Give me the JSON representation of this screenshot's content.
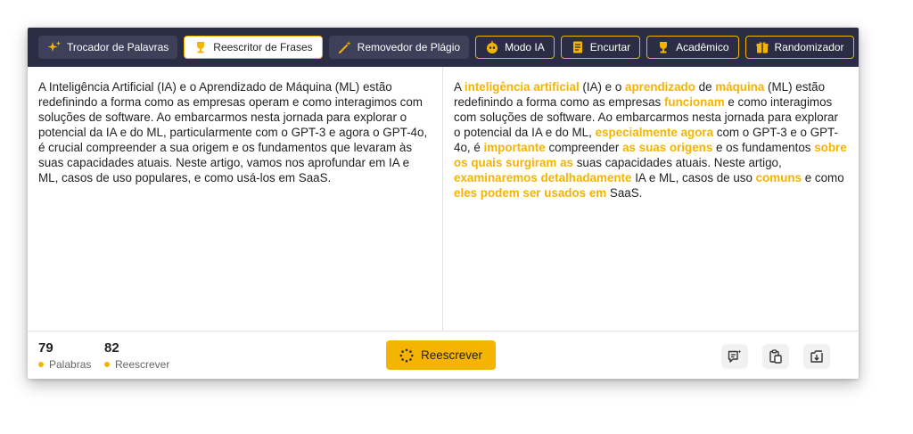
{
  "toolbar": {
    "modes": [
      {
        "label": "Trocador de Palavras",
        "icon": "sparkle-icon"
      },
      {
        "label": "Reescritor de Frases",
        "icon": "trophy-icon"
      },
      {
        "label": "Removedor de Plágio",
        "icon": "magic-wand-icon"
      },
      {
        "label": "Modo IA",
        "icon": "robot-icon"
      },
      {
        "label": "Encurtar",
        "icon": "document-icon"
      },
      {
        "label": "Acadêmico",
        "icon": "trophy-icon"
      },
      {
        "label": "Randomizador",
        "icon": "gift-icon"
      }
    ],
    "active_mode": "Reescritor de Frases"
  },
  "input_text": "A Inteligência Artificial (IA) e o Aprendizado de Máquina (ML) estão redefinindo a forma como as empresas operam e como interagimos com soluções de software. Ao embarcarmos nesta jornada para explorar o potencial da IA e do ML, particularmente com o GPT-3 e agora o GPT-4o, é crucial compreender a sua origem e os fundamentos que levaram às suas capacidades atuais. Neste artigo, vamos nos aprofundar em IA e ML, casos de uso populares, e como usá-los em SaaS.",
  "output_segments": [
    {
      "text": "A ",
      "changed": false
    },
    {
      "text": "inteligência artificial",
      "changed": true
    },
    {
      "text": " (IA) e o ",
      "changed": false
    },
    {
      "text": "aprendizado",
      "changed": true
    },
    {
      "text": " de ",
      "changed": false
    },
    {
      "text": "máquina",
      "changed": true
    },
    {
      "text": " (ML) estão redefinindo a forma como as empresas ",
      "changed": false
    },
    {
      "text": "funcionam",
      "changed": true
    },
    {
      "text": " e como interagimos com soluções de software. Ao embarcarmos nesta jornada para explorar o potencial da IA e do ML, ",
      "changed": false
    },
    {
      "text": "especialmente agora",
      "changed": true
    },
    {
      "text": " com o GPT-3 e o GPT-4o, é ",
      "changed": false
    },
    {
      "text": "importante",
      "changed": true
    },
    {
      "text": " compreender ",
      "changed": false
    },
    {
      "text": "as suas origens",
      "changed": true
    },
    {
      "text": " e os fundamentos ",
      "changed": false
    },
    {
      "text": "sobre os quais surgiram as",
      "changed": true
    },
    {
      "text": " suas capacidades atuais. Neste artigo, ",
      "changed": false
    },
    {
      "text": "examinaremos detalhadamente",
      "changed": true
    },
    {
      "text": " IA e ML, casos de uso ",
      "changed": false
    },
    {
      "text": "comuns",
      "changed": true
    },
    {
      "text": " e como ",
      "changed": false
    },
    {
      "text": "eles podem ser usados em",
      "changed": true
    },
    {
      "text": " SaaS.",
      "changed": false
    }
  ],
  "stats": {
    "words_count": "79",
    "words_label": "Palabras",
    "rewrite_count": "82",
    "rewrite_label": "Reescrever"
  },
  "rewrite_button": {
    "label": "Reescrever",
    "icon": "spinner-icon"
  },
  "tools": [
    {
      "name": "feedback-icon"
    },
    {
      "name": "copy-icon"
    },
    {
      "name": "download-icon"
    }
  ],
  "colors": {
    "toolbar_bg": "#2b2d44",
    "accent": "#f5b400",
    "highlight_text": "#f5b400"
  }
}
